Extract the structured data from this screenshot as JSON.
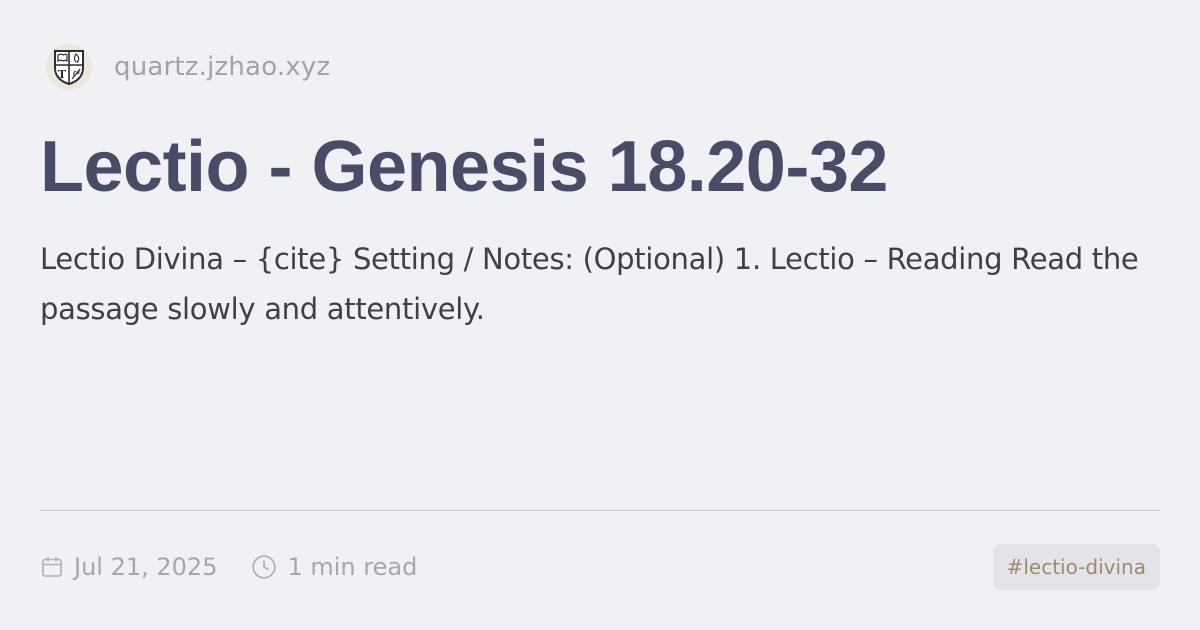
{
  "site": {
    "name": "quartz.jzhao.xyz",
    "logo_icon": "shield-crest-icon"
  },
  "article": {
    "title": "Lectio - Genesis 18.20-32",
    "description": "Lectio Divina – {cite} Setting / Notes: (Optional) 1. Lectio – Reading Read the passage slowly and attentively."
  },
  "meta": {
    "date": "Jul 21, 2025",
    "date_icon": "calendar-icon",
    "reading_time": "1 min read",
    "reading_time_icon": "clock-icon"
  },
  "tags": [
    "#lectio-divina"
  ],
  "colors": {
    "background": "#f0f1f5",
    "title": "#4a4b66",
    "text": "#3f3f4a",
    "muted": "#a6a6ae",
    "tag_text": "#a08a6c",
    "tag_background": "#e3e4e9"
  }
}
